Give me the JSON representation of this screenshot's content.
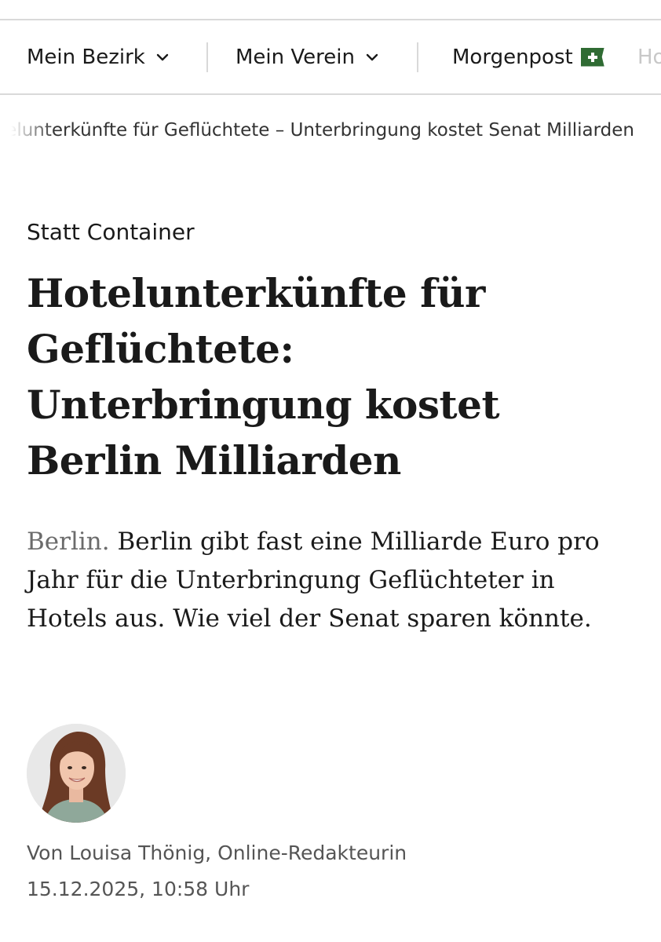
{
  "nav": {
    "items": [
      {
        "label": "Mein Bezirk",
        "icon": "chevron-down-icon"
      },
      {
        "label": "Mein Verein",
        "icon": "chevron-down-icon"
      },
      {
        "label": "Morgenpost",
        "icon": "plus-badge-icon"
      }
    ],
    "overflow_label": "Ho",
    "plus_color": "#2f6b33"
  },
  "breadcrumb": {
    "text": "Hotelunterkünfte für Geflüchtete – Unterbringung kostet Senat Milliarden"
  },
  "article": {
    "kicker": "Statt Container",
    "headline": "Hotelunterkünfte für Geflüchtete: Unterbringung kostet Berlin Milliarden",
    "dateline": "Berlin.",
    "lead": "Berlin gibt fast eine Milliarde Euro pro Jahr für die Unterbringung Geflüchteter in Hotels aus. Wie viel der Senat sparen könnte.",
    "author_line": "Von Louisa Thönig, Online-Redakteurin",
    "published": "15.12.2025, 10:58 Uhr"
  }
}
